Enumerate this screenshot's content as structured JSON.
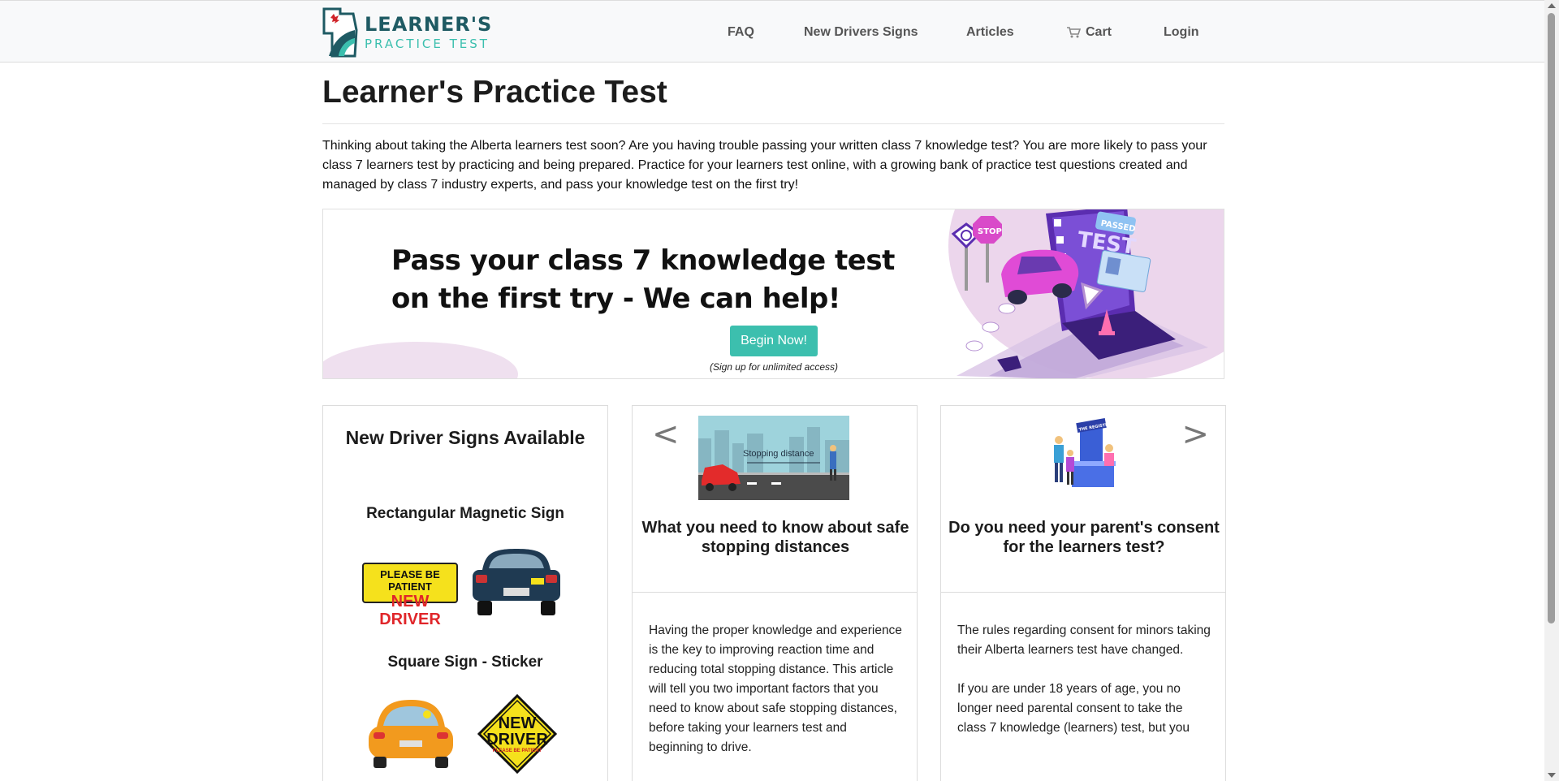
{
  "brand": {
    "line1": "LEARNER'S",
    "line2": "PRACTICE TEST",
    "colors": {
      "dark": "#1e5a63",
      "accent": "#3bbfae",
      "red": "#d0242a"
    }
  },
  "nav": {
    "faq": "FAQ",
    "signs": "New Drivers Signs",
    "articles": "Articles",
    "cart": "Cart",
    "cart_icon": "cart-icon",
    "login": "Login"
  },
  "main": {
    "title": "Learner's Practice Test",
    "intro": "Thinking about taking the Alberta learners test soon? Are you having trouble passing your written class 7 knowledge test? You are more likely to pass your class 7 learners test by practicing and being prepared. Practice for your learners test online, with a growing bank of practice test questions created and managed by class 7 industry experts, and pass your knowledge test on the first try!"
  },
  "banner": {
    "headline_line1": "Pass your class 7 knowledge test",
    "headline_line2": "on the first try - We can help!",
    "button": "Begin Now!",
    "note": "(Sign up for unlimited access)",
    "art_labels": {
      "stop": "STOP",
      "test": "TEST",
      "passed": "PASSED"
    },
    "accent_color": "#3cbfae"
  },
  "signs_card": {
    "title": "New Driver Signs Available",
    "sub1": "Rectangular Magnetic Sign",
    "sub2": "Square Sign - Sticker",
    "patient_line1": "PLEASE BE PATIENT",
    "patient_line2": "NEW DRIVER",
    "diamond_line1": "NEW",
    "diamond_line2": "DRIVER",
    "diamond_line3": "PLEASE BE PATIENT"
  },
  "articles": [
    {
      "title": "What you need to know about safe stopping distances",
      "image_caption": "Stopping distance",
      "body": [
        "Having the proper knowledge and experience is the key to improving reaction time and reducing total stopping distance. This article will tell you two important factors that you need to know about safe stopping distances, before taking your learners test and beginning to drive."
      ]
    },
    {
      "title": "Do you need your parent's consent for the learners test?",
      "image_caption": "THE REGISTRY",
      "body": [
        "The rules regarding consent for minors taking their Alberta learners test have changed.",
        "If you are under 18 years of age, you no longer need parental consent to take the class 7 knowledge (learners) test, but you"
      ]
    }
  ],
  "carousel": {
    "prev": "<",
    "next": ">"
  }
}
